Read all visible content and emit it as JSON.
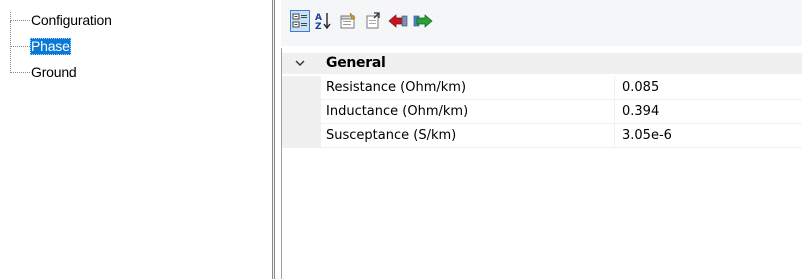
{
  "tree": {
    "items": [
      {
        "label": "Configuration",
        "selected": false
      },
      {
        "label": "Phase",
        "selected": true
      },
      {
        "label": "Ground",
        "selected": false
      }
    ]
  },
  "toolbar": {
    "buttons": [
      {
        "icon": "categorized-view-icon",
        "active": true
      },
      {
        "icon": "alphabetical-sort-icon",
        "active": false
      },
      {
        "icon": "property-pages-icon",
        "active": false
      },
      {
        "icon": "export-icon",
        "active": false
      },
      {
        "icon": "red-arrow-icon",
        "active": false
      },
      {
        "icon": "green-arrow-icon",
        "active": false
      }
    ]
  },
  "grid": {
    "category": "General",
    "properties": [
      {
        "name": "Resistance (Ohm/km)",
        "value": "0.085"
      },
      {
        "name": "Inductance (Ohm/km)",
        "value": "0.394"
      },
      {
        "name": "Susceptance (S/km)",
        "value": "3.05e-6"
      }
    ]
  },
  "colors": {
    "selection": "#0a78d7",
    "gutter": "#f0f0f0",
    "toolbar": "#f5f6f7"
  }
}
